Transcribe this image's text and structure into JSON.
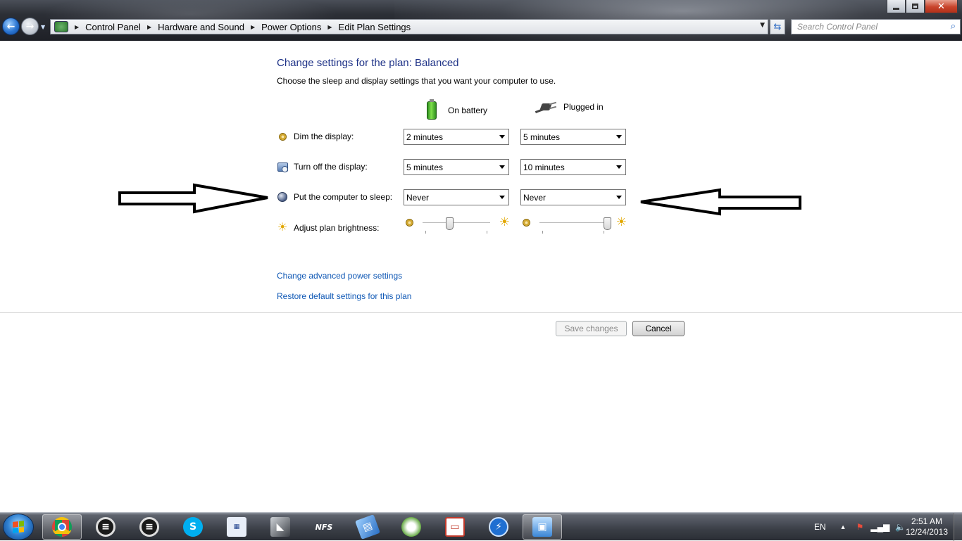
{
  "window": {
    "title_buttons": [
      "minimize",
      "maximize",
      "close"
    ]
  },
  "address_bar": {
    "crumbs": [
      "Control Panel",
      "Hardware and Sound",
      "Power Options",
      "Edit Plan Settings"
    ]
  },
  "search": {
    "placeholder": "Search Control Panel"
  },
  "content": {
    "heading": "Change settings for the plan: Balanced",
    "subheading": "Choose the sleep and display settings that you want your computer to use.",
    "columns": {
      "battery": "On battery",
      "plugged": "Plugged in"
    },
    "rows": {
      "dim": {
        "label": "Dim the display:",
        "battery": "2 minutes",
        "plugged": "5 minutes"
      },
      "off": {
        "label": "Turn off the display:",
        "battery": "5 minutes",
        "plugged": "10 minutes"
      },
      "sleep": {
        "label": "Put the computer to sleep:",
        "battery": "Never",
        "plugged": "Never"
      },
      "brightness": {
        "label": "Adjust plan brightness:",
        "battery_level": 0.4,
        "plugged_level": 1.0
      }
    },
    "links": {
      "advanced": "Change advanced power settings",
      "restore": "Restore default settings for this plan"
    },
    "buttons": {
      "save": "Save changes",
      "cancel": "Cancel"
    }
  },
  "taskbar": {
    "apps": [
      "start",
      "chrome",
      "app-ring-1",
      "app-ring-2",
      "skype",
      "meter",
      "app-dark",
      "nfs",
      "app-book",
      "app-flower",
      "app-red",
      "app-bolt",
      "control-panel"
    ],
    "language": "EN",
    "clock": {
      "time": "2:51 AM",
      "date": "12/24/2013"
    }
  },
  "colors": {
    "heading": "#1e3287",
    "link": "#0f58b5"
  }
}
